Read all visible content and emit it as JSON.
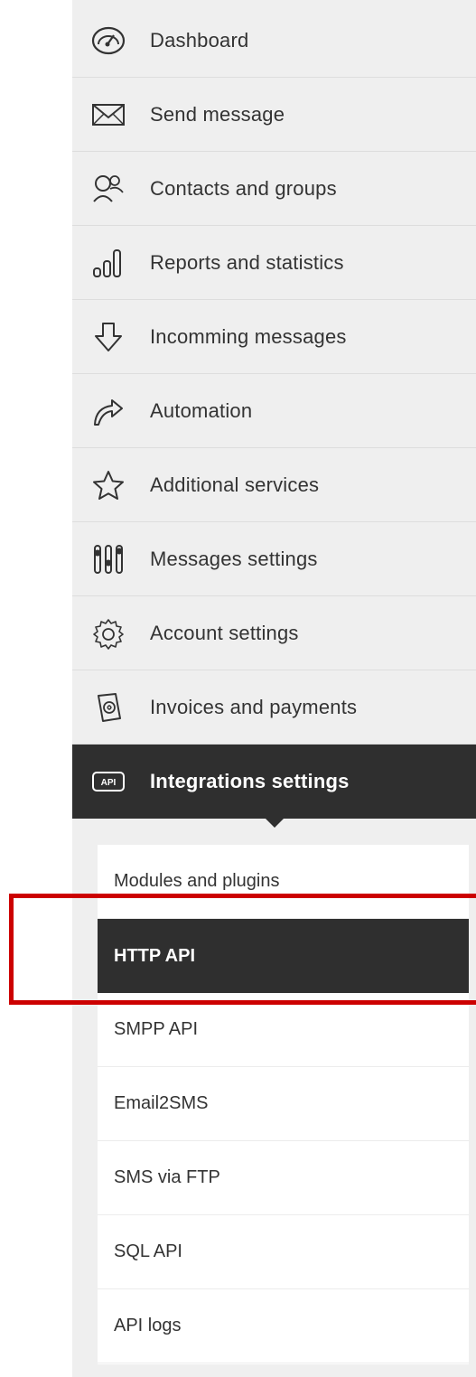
{
  "menu": {
    "items": [
      {
        "label": "Dashboard",
        "icon": "gauge-icon"
      },
      {
        "label": "Send message",
        "icon": "envelope-icon"
      },
      {
        "label": "Contacts and groups",
        "icon": "contacts-icon"
      },
      {
        "label": "Reports and statistics",
        "icon": "bar-chart-icon"
      },
      {
        "label": "Incomming messages",
        "icon": "arrow-down-icon"
      },
      {
        "label": "Automation",
        "icon": "curved-arrow-icon"
      },
      {
        "label": "Additional services",
        "icon": "star-icon"
      },
      {
        "label": "Messages settings",
        "icon": "sliders-icon"
      },
      {
        "label": "Account settings",
        "icon": "gear-icon"
      },
      {
        "label": "Invoices and payments",
        "icon": "invoice-icon"
      },
      {
        "label": "Integrations settings",
        "icon": "api-icon",
        "active": true
      }
    ]
  },
  "submenu": {
    "items": [
      {
        "label": "Modules and plugins"
      },
      {
        "label": "HTTP API",
        "active": true
      },
      {
        "label": "SMPP API"
      },
      {
        "label": "Email2SMS"
      },
      {
        "label": "SMS via FTP"
      },
      {
        "label": "SQL API"
      },
      {
        "label": "API logs"
      }
    ]
  },
  "colors": {
    "active_background": "#2f2f2f",
    "sidebar_background": "#efefef",
    "highlight_border": "#cc0000"
  }
}
